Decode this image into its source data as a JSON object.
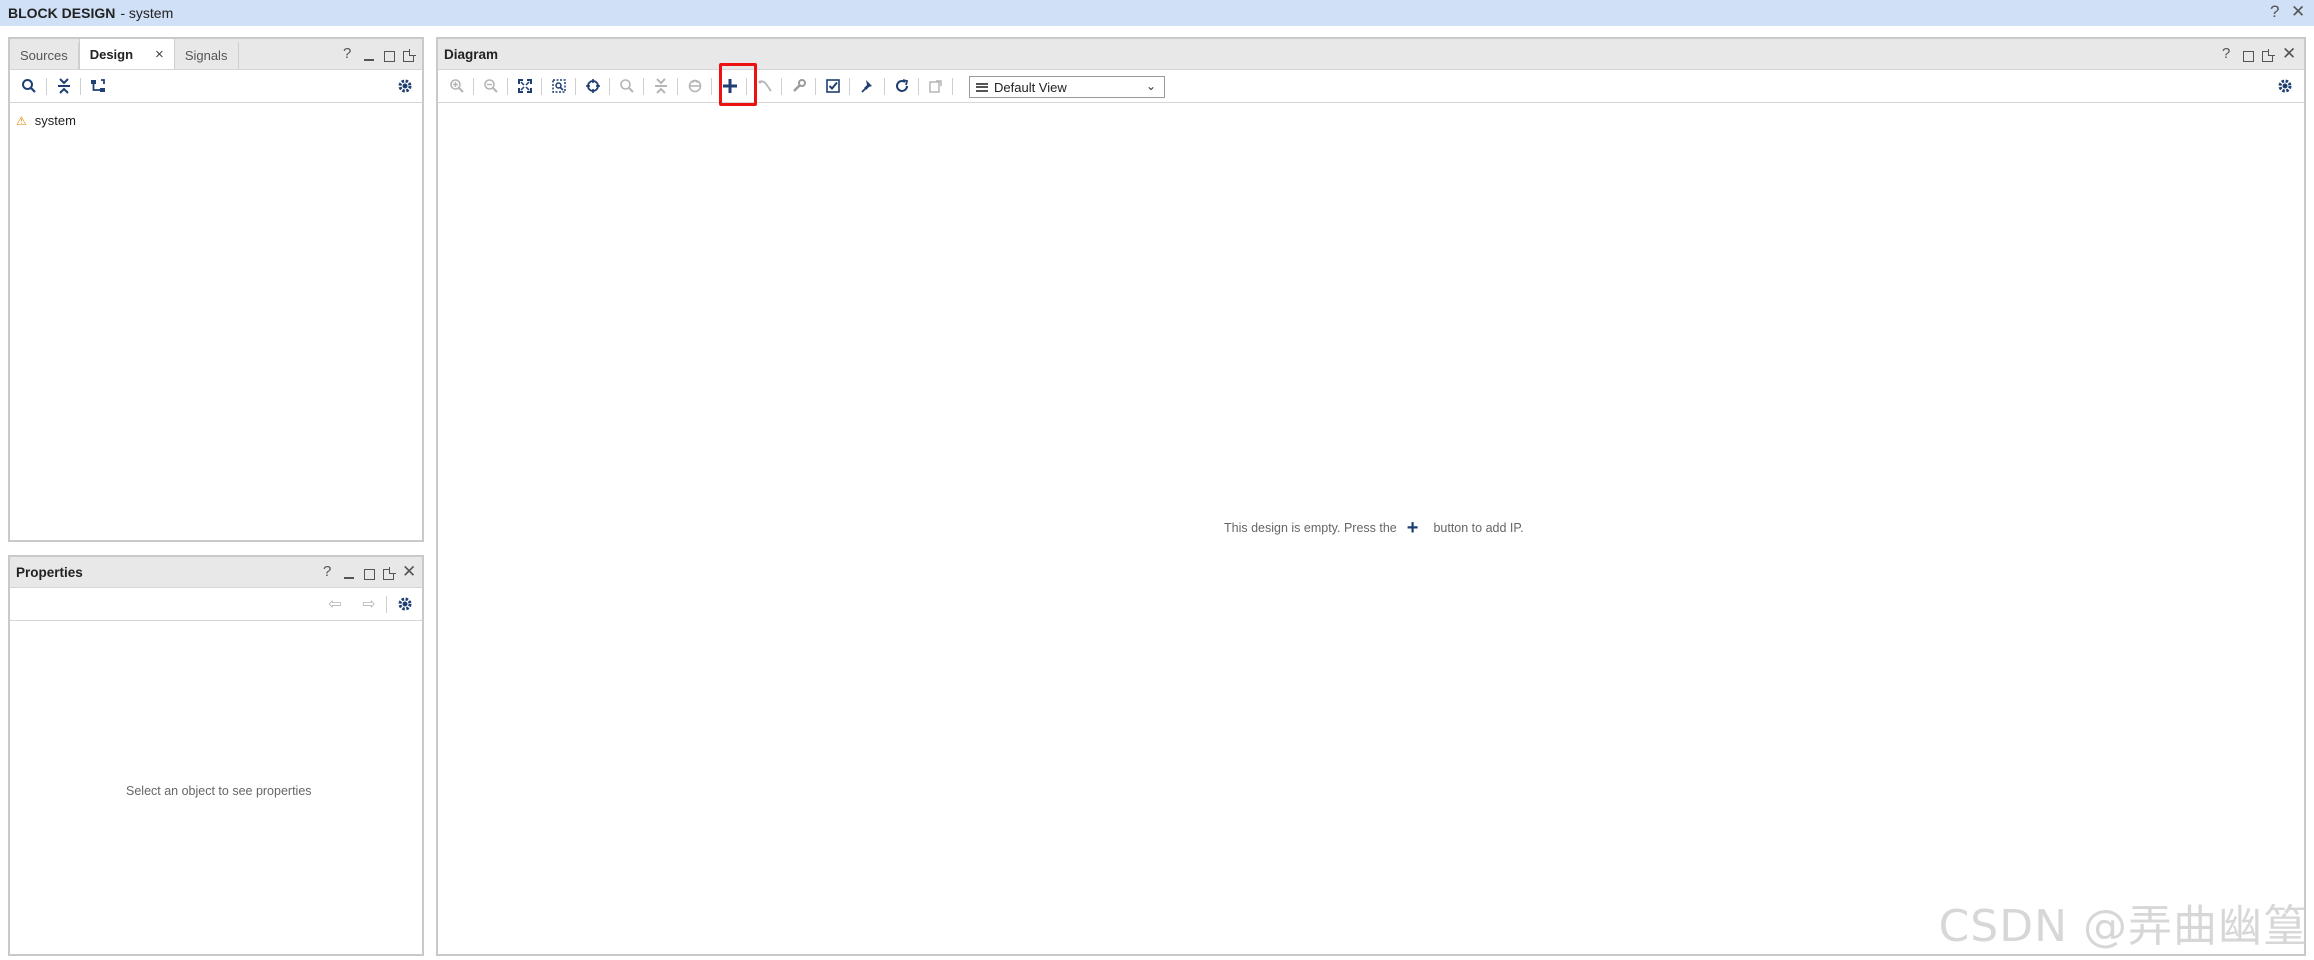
{
  "window": {
    "title_bold": "BLOCK DESIGN",
    "title_rest": "- system",
    "help": "?",
    "close": "✕"
  },
  "left_top_panel": {
    "tabs": [
      {
        "label": "Sources"
      },
      {
        "label": "Design",
        "close": "×"
      },
      {
        "label": "Signals"
      }
    ],
    "tree": [
      {
        "label": "system",
        "icon": "hierarchy-warning-icon"
      }
    ]
  },
  "properties_panel": {
    "title": "Properties",
    "empty_message": "Select an object to see properties"
  },
  "diagram_panel": {
    "title": "Diagram",
    "view_select": "Default View",
    "empty_message_before": "This design is empty. Press the",
    "empty_message_after": "button to add IP."
  },
  "watermark": "CSDN @弄曲幽篁",
  "colors": {
    "titlebar": "#cfe0f7",
    "panel_header": "#e8e8e8",
    "icon_blue": "#1f3f73",
    "highlight_red": "#e11111"
  }
}
